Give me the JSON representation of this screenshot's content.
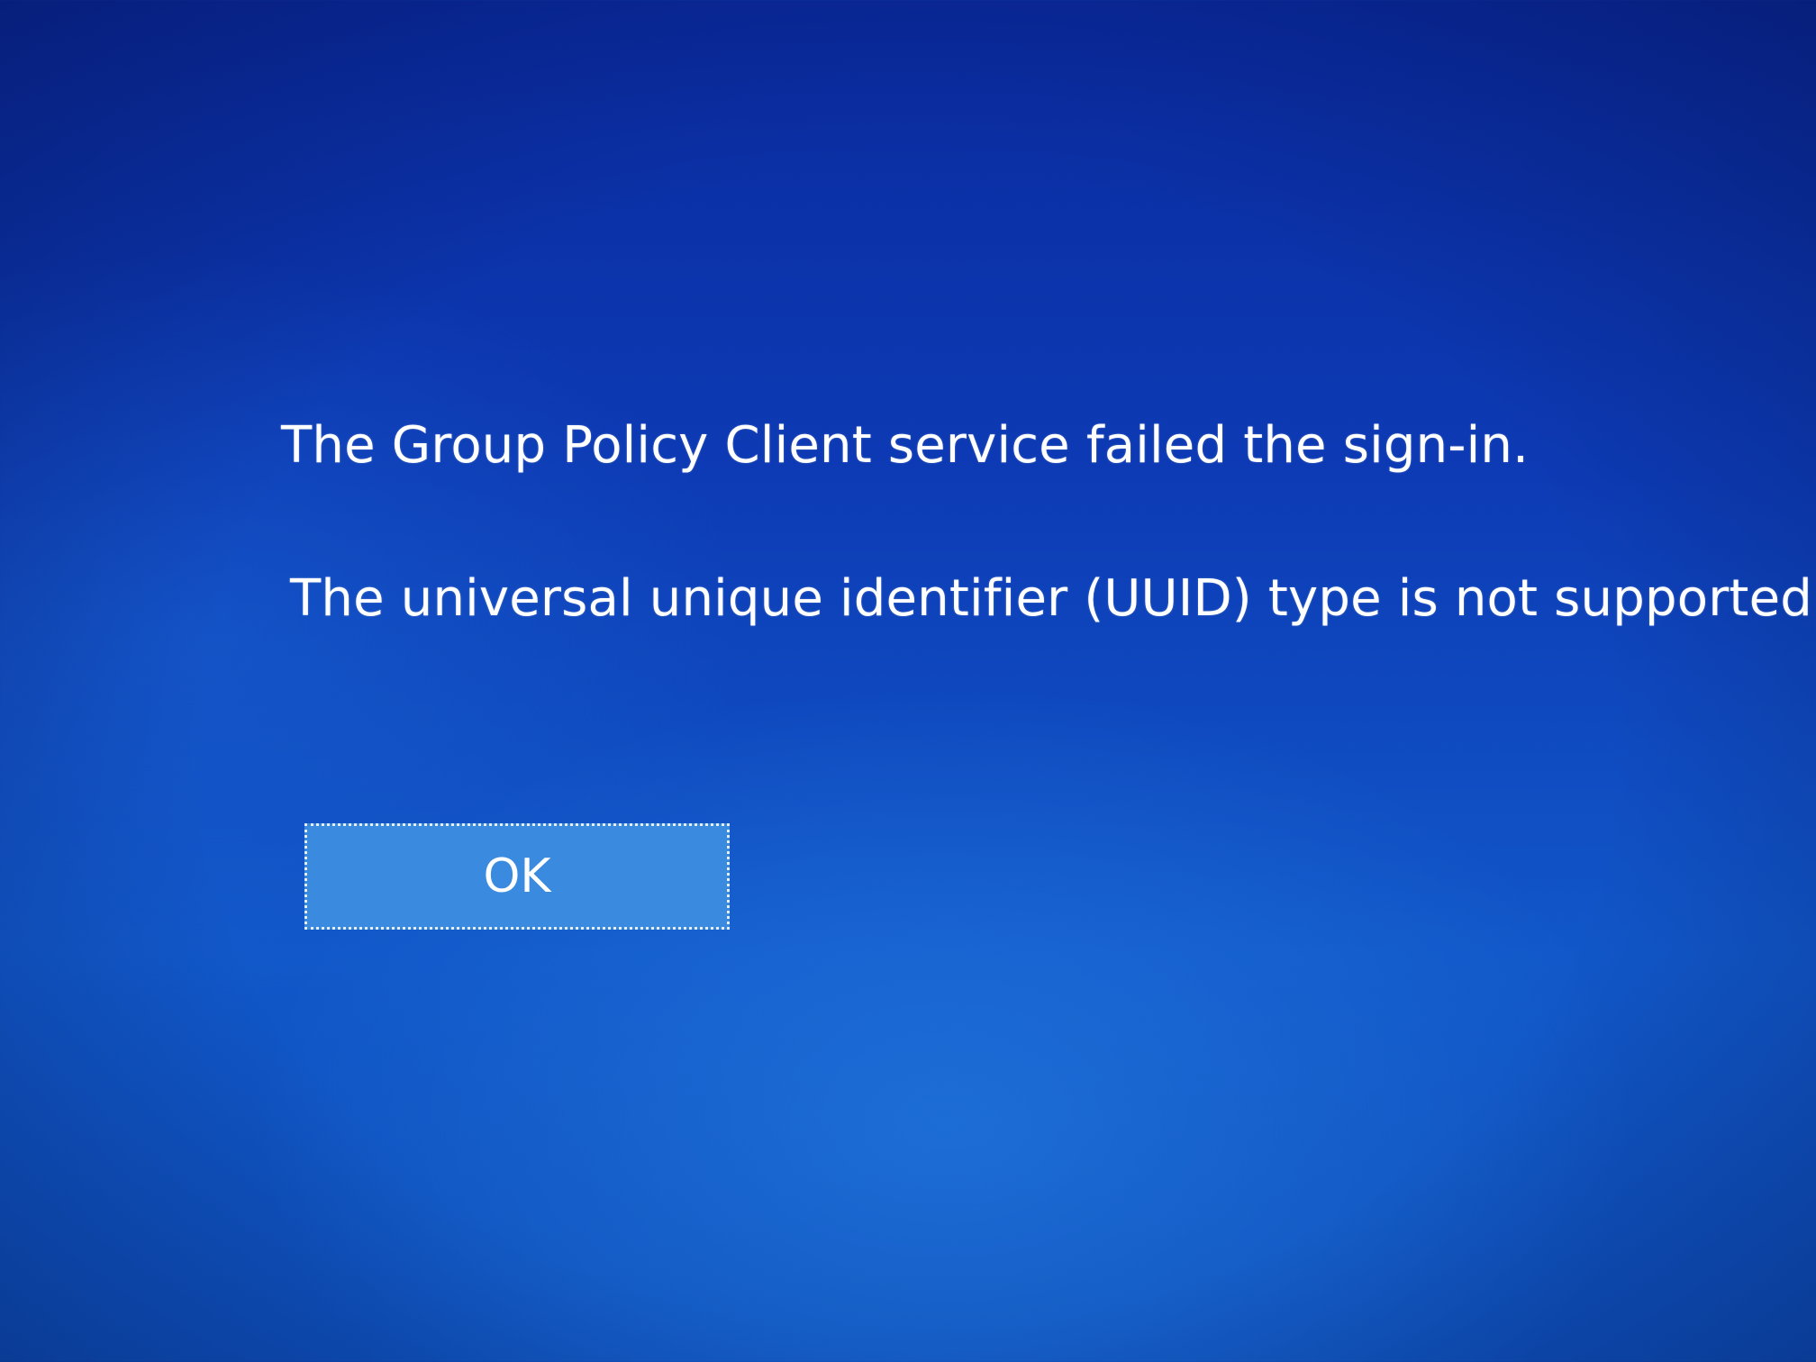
{
  "dialog": {
    "title_message": "The Group Policy Client service failed the sign-in.",
    "detail_message": "The universal unique identifier (UUID) type is not supported.",
    "ok_label": "OK"
  },
  "colors": {
    "background_top": "#0a2a9e",
    "background_bottom": "#1157c9",
    "button_fill": "#3a8be0",
    "text": "#ffffff"
  }
}
